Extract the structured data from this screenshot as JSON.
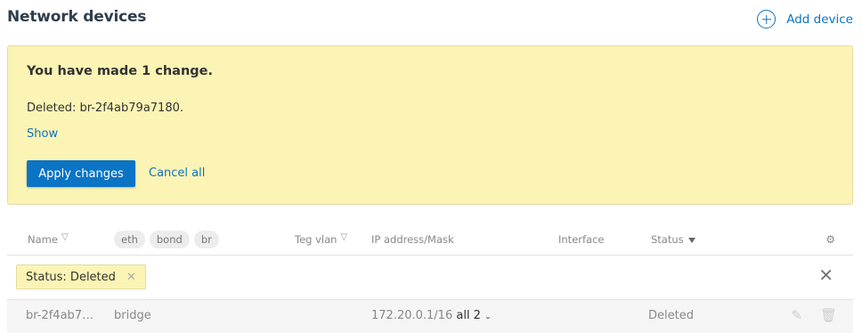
{
  "header": {
    "title": "Network devices",
    "add_device_label": "Add device"
  },
  "notice": {
    "title": "You have made 1 change.",
    "deleted_text": "Deleted: br-2f4ab79a7180.",
    "show_label": "Show",
    "apply_label": "Apply changes",
    "cancel_label": "Cancel all"
  },
  "table": {
    "columns": {
      "name": "Name",
      "teg_vlan": "Teg vlan",
      "ip_mask": "IP address/Mask",
      "interface": "Interface",
      "status": "Status"
    },
    "type_chips": [
      "eth",
      "bond",
      "br"
    ],
    "filter": {
      "label": "Status: Deleted"
    },
    "rows": [
      {
        "name": "br-2f4ab7…",
        "type": "bridge",
        "ip": "172.20.0.1/16",
        "all_label": "all 2",
        "status": "Deleted"
      }
    ]
  },
  "colors": {
    "accent": "#0b74c4",
    "notice_bg": "#fbf4b5",
    "row_bg": "#f5f5f5"
  },
  "icons": [
    "plus-circle-icon",
    "filter-icon",
    "gear-icon",
    "close-icon",
    "pencil-icon",
    "trash-icon",
    "chevron-down-icon"
  ]
}
